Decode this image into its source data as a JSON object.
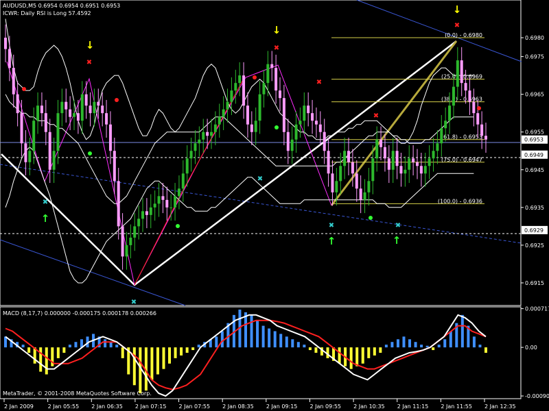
{
  "header": {
    "symbol_line": "AUDUSD,M5  0.6954 0.6954 0.6951 0.6953",
    "indicator_line": "ICWR: Daily RSI is Long 57.4592"
  },
  "macd_label": "MACD  (8,17,7) 0.000000 -0.000175 0.000178 0.000266",
  "copyright": "MetaTrader, © 2001-2008 MetaQuotes Software Corp.",
  "colors": {
    "background": "#000000",
    "bull_candle": "#2db82d",
    "bear_candle": "#ff9cff",
    "bollinger": "#ffffff",
    "fib_line": "#d6d04a",
    "macd_pos_hist": "#3f8fff",
    "macd_neg_hist": "#ffff33",
    "macd_signal": "#ff2020",
    "macd_main": "#ffffff",
    "trend_blue": "#3a57d6"
  },
  "chart_data": {
    "type": "candlestick",
    "symbol": "AUDUSD",
    "timeframe": "M5",
    "ylim": [
      0.6909,
      0.699
    ],
    "y_ticks": [
      "0.6980",
      "0.6975",
      "0.6965",
      "0.6955",
      "0.6945",
      "0.6935",
      "0.6925",
      "0.6915"
    ],
    "y_ticks_values": [
      0.698,
      0.6975,
      0.6965,
      0.6955,
      0.6945,
      0.6935,
      0.6925,
      0.6915
    ],
    "price_tags": [
      {
        "label": "0.6953",
        "value": 0.6953
      },
      {
        "label": "0.6949",
        "value": 0.6949
      },
      {
        "label": "0.6929",
        "value": 0.6929
      }
    ],
    "x_ticks": [
      "2 Jan 2009",
      "2 Jan 05:55",
      "2 Jan 06:35",
      "2 Jan 07:15",
      "2 Jan 07:55",
      "2 Jan 08:35",
      "2 Jan 09:15",
      "2 Jan 09:55",
      "2 Jan 10:35",
      "2 Jan 11:15",
      "2 Jan 11:55",
      "2 Jan 12:35"
    ],
    "close": [
      0.6977,
      0.6972,
      0.6965,
      0.696,
      0.6952,
      0.6947,
      0.695,
      0.6958,
      0.6962,
      0.696,
      0.6955,
      0.6945,
      0.695,
      0.696,
      0.6963,
      0.6961,
      0.6959,
      0.696,
      0.6958,
      0.6965,
      0.6962,
      0.696,
      0.6963,
      0.6962,
      0.696,
      0.6957,
      0.695,
      0.6942,
      0.693,
      0.6922,
      0.6925,
      0.6927,
      0.693,
      0.6932,
      0.6934,
      0.6933,
      0.6935,
      0.6936,
      0.6938,
      0.6937,
      0.6935,
      0.6935,
      0.6938,
      0.694,
      0.6944,
      0.6948,
      0.695,
      0.6952,
      0.6953,
      0.6955,
      0.6954,
      0.6955,
      0.6957,
      0.6959,
      0.6961,
      0.6963,
      0.6966,
      0.6968,
      0.697,
      0.6962,
      0.6957,
      0.6955,
      0.6958,
      0.6965,
      0.6968,
      0.6973,
      0.6972,
      0.6966,
      0.6964,
      0.6955,
      0.695,
      0.6953,
      0.6957,
      0.6958,
      0.6962,
      0.696,
      0.6958,
      0.6957,
      0.6955,
      0.695,
      0.6944,
      0.6939,
      0.6942,
      0.6946,
      0.695,
      0.6947,
      0.6944,
      0.694,
      0.6937,
      0.6939,
      0.6942,
      0.6948,
      0.6953,
      0.6951,
      0.6948,
      0.6945,
      0.695,
      0.6946,
      0.6944,
      0.6945,
      0.6948,
      0.6947,
      0.6946,
      0.6944,
      0.6946,
      0.6948,
      0.695,
      0.6952,
      0.6956,
      0.6958,
      0.6962,
      0.6967,
      0.6974,
      0.6968,
      0.6966,
      0.6963,
      0.696,
      0.6957,
      0.6954,
      0.6953
    ],
    "bollinger": {
      "upper": [
        0.6985,
        0.6978,
        0.6972,
        0.6968,
        0.6967,
        0.6966,
        0.6966,
        0.6967,
        0.6971,
        0.6974,
        0.6976,
        0.6977,
        0.6978,
        0.6977,
        0.6975,
        0.6972,
        0.6968,
        0.6963,
        0.6958,
        0.6955,
        0.6953,
        0.6954,
        0.6957,
        0.6962,
        0.6966,
        0.6968,
        0.6969,
        0.697,
        0.697,
        0.6968,
        0.6965,
        0.6962,
        0.6959,
        0.6956,
        0.6954,
        0.6954,
        0.6956,
        0.6959,
        0.6961,
        0.696,
        0.6958,
        0.6956,
        0.6955,
        0.6956,
        0.6958,
        0.696,
        0.6962,
        0.6964,
        0.6967,
        0.697,
        0.6972,
        0.6973,
        0.6972,
        0.6969,
        0.6966,
        0.6963,
        0.6961,
        0.696,
        0.6961,
        0.6963,
        0.6965,
        0.6967,
        0.6968,
        0.6969,
        0.6968,
        0.6966,
        0.6964,
        0.6962,
        0.696,
        0.6959,
        0.6958,
        0.6957,
        0.6956,
        0.6955,
        0.6955,
        0.6954,
        0.6954,
        0.6953,
        0.6953,
        0.6953,
        0.6954,
        0.6954,
        0.6955,
        0.6955,
        0.6955,
        0.6956,
        0.6956,
        0.6957,
        0.6957,
        0.6958,
        0.6958,
        0.6958,
        0.6958,
        0.6957,
        0.6956,
        0.6955,
        0.6954,
        0.6953,
        0.6952,
        0.6952,
        0.6953,
        0.6955,
        0.6958,
        0.6962,
        0.6965,
        0.6968,
        0.697,
        0.6971,
        0.6972,
        0.6972,
        0.6971,
        0.697,
        0.697,
        0.697,
        0.697,
        0.697,
        0.697
      ],
      "middle": [
        0.6965,
        0.6963,
        0.6962,
        0.6961,
        0.696,
        0.696,
        0.6959,
        0.6959,
        0.6958,
        0.6958,
        0.6958,
        0.6957,
        0.6957,
        0.6956,
        0.6956,
        0.6955,
        0.6954,
        0.6953,
        0.6952,
        0.695,
        0.6948,
        0.6946,
        0.6944,
        0.6942,
        0.694,
        0.6938,
        0.6937,
        0.6936,
        0.6936,
        0.6937,
        0.6938,
        0.694,
        0.6942,
        0.6944,
        0.6946,
        0.6948,
        0.695,
        0.6952,
        0.6953,
        0.6954,
        0.6955,
        0.6955,
        0.6955,
        0.6955,
        0.6955,
        0.6955,
        0.6955,
        0.6955,
        0.6955,
        0.6956,
        0.6957,
        0.6958,
        0.6959,
        0.6959,
        0.6959,
        0.6958,
        0.6957,
        0.6956,
        0.6955,
        0.6954,
        0.6953,
        0.6952,
        0.6951,
        0.695,
        0.6949,
        0.6948,
        0.6947,
        0.6946,
        0.6946,
        0.6946,
        0.6946,
        0.6946,
        0.6946,
        0.6946,
        0.6946,
        0.6946,
        0.6946,
        0.6946,
        0.6946,
        0.6946,
        0.6946,
        0.6946,
        0.6947,
        0.6947,
        0.6948,
        0.6949,
        0.695,
        0.6951,
        0.6952,
        0.6953,
        0.6954,
        0.6954,
        0.6955,
        0.6955,
        0.6955,
        0.6955,
        0.6954,
        0.6954,
        0.6953,
        0.6953,
        0.6952,
        0.6952,
        0.6952,
        0.6952,
        0.6953,
        0.6953,
        0.6954,
        0.6955,
        0.6956,
        0.6957,
        0.6958,
        0.6959,
        0.6959,
        0.6959,
        0.6959,
        0.6959,
        0.6959
      ],
      "lower": [
        0.6935,
        0.6938,
        0.6942,
        0.6945,
        0.6948,
        0.695,
        0.6951,
        0.695,
        0.6947,
        0.6944,
        0.6941,
        0.6938,
        0.6934,
        0.693,
        0.6926,
        0.6922,
        0.6918,
        0.6916,
        0.6915,
        0.6915,
        0.6916,
        0.6918,
        0.692,
        0.6922,
        0.6924,
        0.6926,
        0.6927,
        0.6928,
        0.6929,
        0.693,
        0.6931,
        0.6932,
        0.6934,
        0.6936,
        0.6938,
        0.694,
        0.6941,
        0.6942,
        0.6942,
        0.6941,
        0.694,
        0.6939,
        0.6938,
        0.6937,
        0.6936,
        0.6935,
        0.6935,
        0.6934,
        0.6934,
        0.6934,
        0.6934,
        0.6935,
        0.6935,
        0.6936,
        0.6937,
        0.6938,
        0.6939,
        0.694,
        0.6941,
        0.6942,
        0.6943,
        0.6943,
        0.6942,
        0.6941,
        0.694,
        0.6939,
        0.6938,
        0.6937,
        0.6936,
        0.6936,
        0.6936,
        0.6936,
        0.6936,
        0.6936,
        0.6937,
        0.6937,
        0.6937,
        0.6937,
        0.6937,
        0.6937,
        0.6937,
        0.6937,
        0.6937,
        0.6937,
        0.6937,
        0.6937,
        0.6937,
        0.6937,
        0.6937,
        0.6937,
        0.6937,
        0.6937,
        0.6936,
        0.6936,
        0.6936,
        0.6935,
        0.6935,
        0.6935,
        0.6935,
        0.6936,
        0.6937,
        0.6938,
        0.6939,
        0.694,
        0.6941,
        0.6942,
        0.6943,
        0.6944,
        0.6944,
        0.6944,
        0.6944,
        0.6944,
        0.6944,
        0.6944,
        0.6944,
        0.6944,
        0.6944
      ]
    },
    "fibonacci": [
      {
        "label": "(0.0) - 0.6980",
        "value": 0.698
      },
      {
        "label": "(25.0) - 0.6969",
        "value": 0.6969
      },
      {
        "label": "(38.2) - 0.6963",
        "value": 0.6963
      },
      {
        "label": "(61.8) - 0.6953",
        "value": 0.6953
      },
      {
        "label": "(75.0) - 0.6947",
        "value": 0.6947
      },
      {
        "label": "(100.0) - 0.6936",
        "value": 0.6936
      }
    ],
    "macd": {
      "y_ticks": [
        "0.000717",
        "0.00",
        "-0.00090"
      ],
      "y_ticks_values": [
        0.000717,
        0.0,
        -0.0009
      ],
      "ylim": [
        -0.00095,
        0.00075
      ],
      "histogram": [
        0.0002,
        0.00015,
        0.0001,
        5e-05,
        -0.0001,
        -0.0003,
        -0.00045,
        -0.0005,
        -0.00035,
        -0.0002,
        -0.0001,
        5e-05,
        0.0001,
        0.00015,
        0.0002,
        0.00025,
        0.0002,
        0.00015,
        0.0001,
        5e-05,
        -0.0002,
        -0.0005,
        -0.0007,
        -0.00085,
        -0.0008,
        -0.0006,
        -0.0005,
        -0.0004,
        -0.0003,
        -0.0002,
        -0.00015,
        -0.0001,
        -5e-05,
        5e-05,
        0.0001,
        0.00015,
        0.0002,
        0.0003,
        0.00045,
        0.0006,
        0.0007,
        0.00065,
        0.0006,
        0.0005,
        0.0004,
        0.00035,
        0.0003,
        0.00025,
        0.0002,
        0.00015,
        0.0001,
        5e-05,
        -5e-05,
        -0.0001,
        -0.00015,
        -0.0002,
        -0.00025,
        -0.0003,
        -0.00035,
        -0.0004,
        -0.00035,
        -0.0003,
        -0.0002,
        -0.00015,
        -0.0001,
        5e-05,
        0.0001,
        0.00015,
        0.0002,
        0.00015,
        0.0001,
        5e-05,
        3e-05,
        -5e-05,
        5e-05,
        0.00015,
        0.0003,
        0.00045,
        0.0006,
        0.0004,
        0.0002,
        5e-05,
        -0.0001
      ],
      "main": [
        0.0002,
        0.0001,
        0.0,
        -0.0001,
        -0.0002,
        -0.0003,
        -0.0004,
        -0.0004,
        -0.0003,
        -0.0002,
        -0.0001,
        0.0,
        0.0001,
        0.00015,
        0.0002,
        0.00015,
        0.0001,
        0.0,
        -0.0001,
        -0.0003,
        -0.0005,
        -0.0007,
        -0.00085,
        -0.0009,
        -0.0008,
        -0.0006,
        -0.0004,
        -0.0002,
        0.0,
        0.0001,
        0.0002,
        0.0003,
        0.0004,
        0.0005,
        0.00055,
        0.0006,
        0.0006,
        0.00055,
        0.0005,
        0.0004,
        0.00035,
        0.0003,
        0.00025,
        0.0002,
        0.0001,
        0.0,
        -0.0001,
        -0.0002,
        -0.0003,
        -0.0004,
        -0.0005,
        -0.00055,
        -0.0006,
        -0.0005,
        -0.0004,
        -0.0003,
        -0.0002,
        -0.00015,
        -0.0001,
        -8e-05,
        -5e-05,
        0.0,
        0.0001,
        0.0002,
        0.0004,
        0.0006,
        0.00055,
        0.00045,
        0.0003,
        0.0002
      ],
      "signal": [
        0.00035,
        0.0003,
        0.0002,
        0.0001,
        0.0,
        -0.0001,
        -0.0002,
        -0.0003,
        -0.0003,
        -0.0003,
        -0.00025,
        -0.0002,
        -0.0001,
        0.0,
        0.0001,
        0.0001,
        0.0001,
        0.0,
        -0.0001,
        -0.0002,
        -0.0004,
        -0.0006,
        -0.0007,
        -0.00075,
        -0.00078,
        -0.00075,
        -0.0007,
        -0.0006,
        -0.0005,
        -0.0003,
        -0.0001,
        0.0001,
        0.0002,
        0.0003,
        0.0004,
        0.00045,
        0.0005,
        0.0005,
        0.0005,
        0.00048,
        0.00045,
        0.0004,
        0.00035,
        0.0003,
        0.00025,
        0.0002,
        0.0001,
        0.0,
        -0.0001,
        -0.0002,
        -0.0003,
        -0.00035,
        -0.0004,
        -0.0004,
        -0.00035,
        -0.0003,
        -0.00025,
        -0.0002,
        -0.00015,
        -0.0001,
        -5e-05,
        0.0,
        0.0001,
        0.0002,
        0.0003,
        0.0004,
        0.0004,
        0.0003,
        0.00025,
        0.0002
      ]
    }
  }
}
